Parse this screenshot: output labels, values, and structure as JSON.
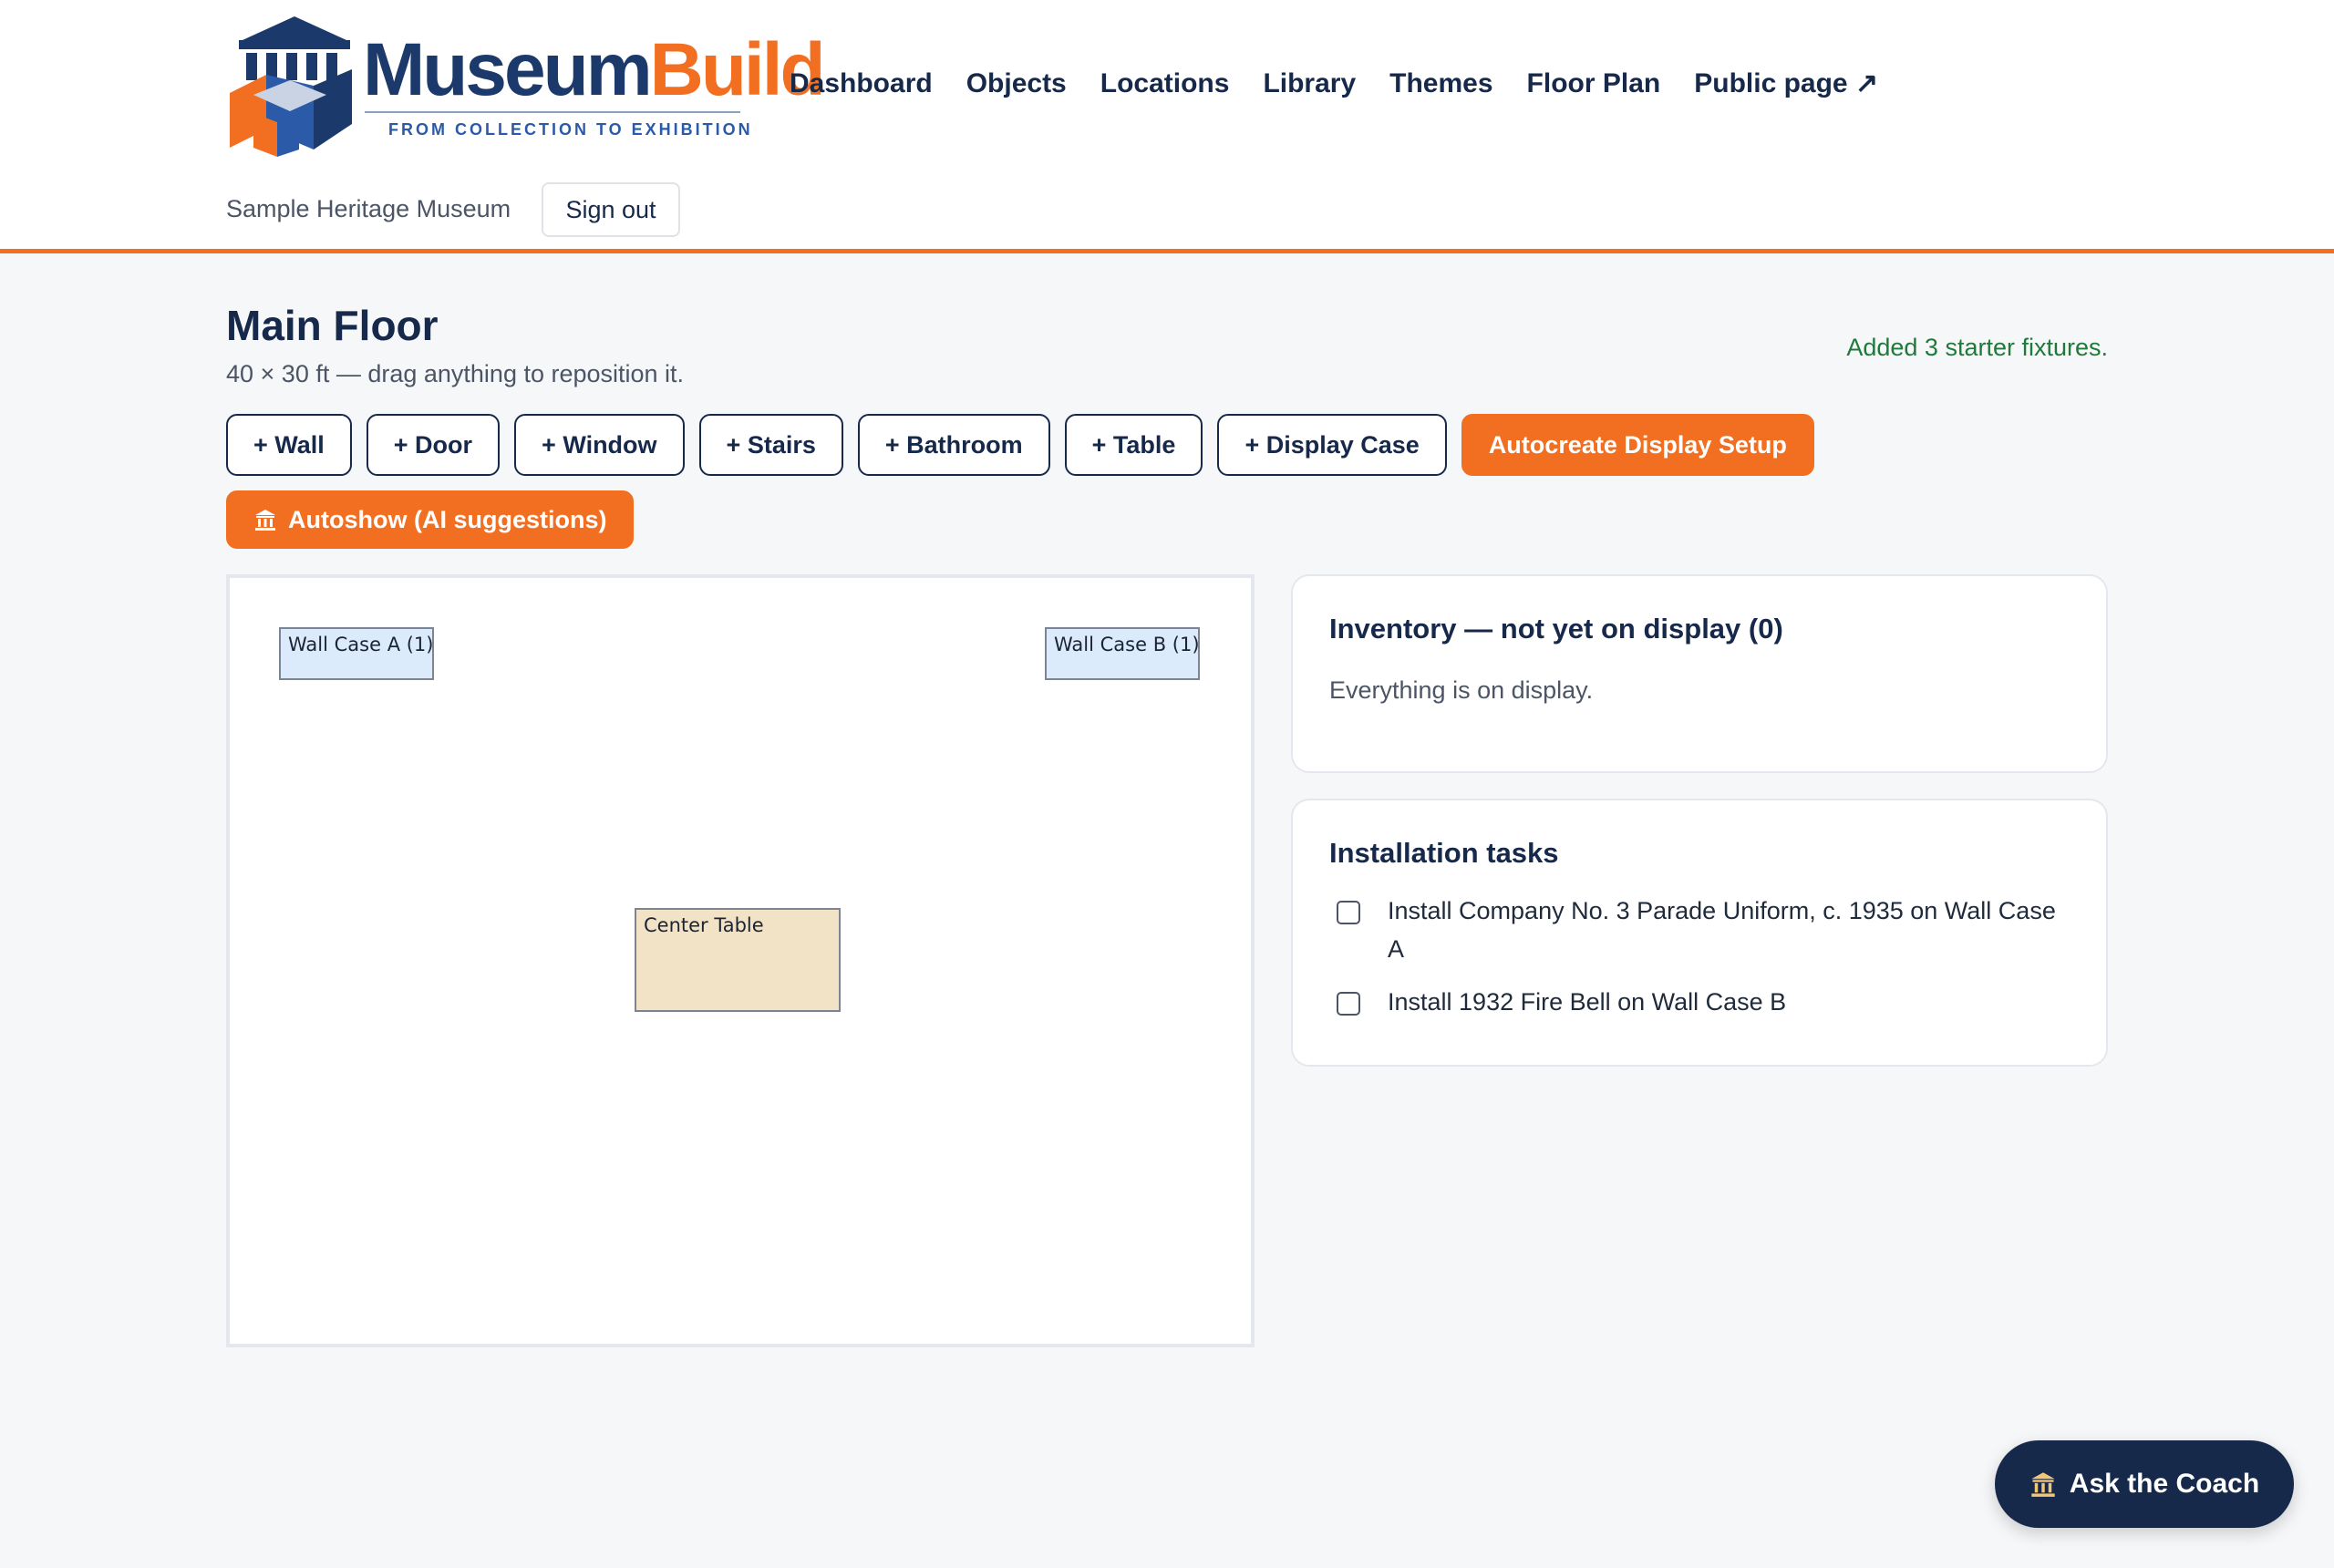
{
  "brand": {
    "word1": "Museum",
    "word2": "Build",
    "tagline": "FROM COLLECTION TO EXHIBITION",
    "colors": {
      "navy": "#1b3a6b",
      "orange": "#f26f21",
      "blue": "#2a5aa8"
    }
  },
  "nav": {
    "items": [
      {
        "label": "Dashboard"
      },
      {
        "label": "Objects"
      },
      {
        "label": "Locations"
      },
      {
        "label": "Library"
      },
      {
        "label": "Themes"
      },
      {
        "label": "Floor Plan"
      },
      {
        "label": "Public page ↗"
      }
    ]
  },
  "account": {
    "org_name": "Sample Heritage Museum",
    "signout_label": "Sign out"
  },
  "page": {
    "title": "Main Floor",
    "subtitle": "40 × 30 ft — drag anything to reposition it.",
    "flash": "Added 3 starter fixtures."
  },
  "toolbar": {
    "buttons": [
      {
        "label": "+ Wall"
      },
      {
        "label": "+ Door"
      },
      {
        "label": "+ Window"
      },
      {
        "label": "+ Stairs"
      },
      {
        "label": "+ Bathroom"
      },
      {
        "label": "+ Table"
      },
      {
        "label": "+ Display Case"
      }
    ],
    "autocreate_label": "Autocreate Display Setup",
    "autoshow_label": "Autoshow (AI suggestions)",
    "autoshow_icon": "museum-icon"
  },
  "floor_plan": {
    "fixtures": [
      {
        "label": "Wall Case A (1)",
        "kind": "wall-case"
      },
      {
        "label": "Wall Case B (1)",
        "kind": "wall-case"
      },
      {
        "label": "Center Table",
        "kind": "table"
      }
    ]
  },
  "inventory": {
    "title": "Inventory — not yet on display (0)",
    "empty_text": "Everything is on display."
  },
  "tasks": {
    "title": "Installation tasks",
    "items": [
      {
        "label": "Install Company No. 3 Parade Uniform, c. 1935 on Wall Case A",
        "checked": false
      },
      {
        "label": "Install 1932 Fire Bell on Wall Case B",
        "checked": false
      }
    ]
  },
  "coach": {
    "label": "Ask the Coach",
    "icon": "museum-icon"
  }
}
